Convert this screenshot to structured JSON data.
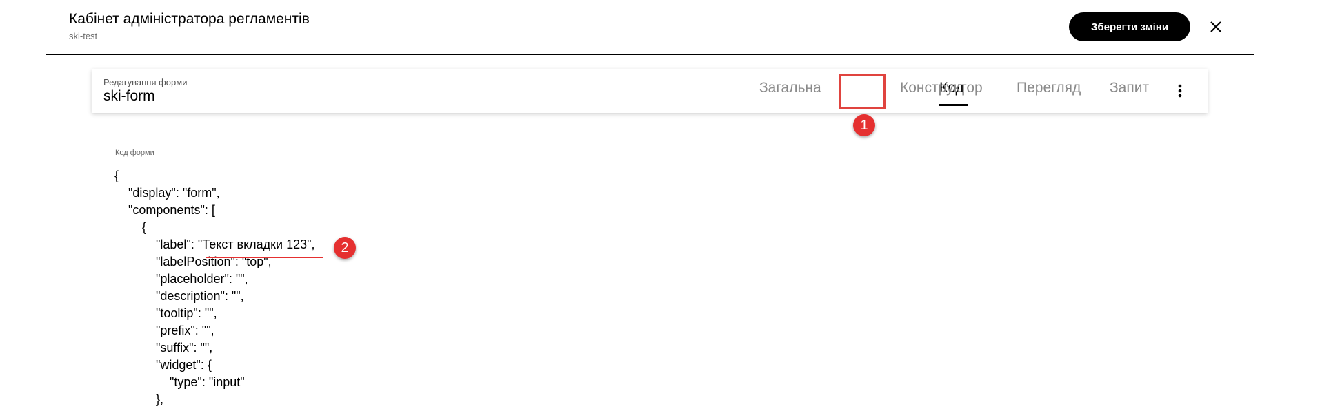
{
  "header": {
    "title": "Кабінет адміністратора регламентів",
    "subtitle": "ski-test",
    "save_label": "Зберегти зміни",
    "close_icon": "close-icon"
  },
  "form_card": {
    "caption": "Редагування форми",
    "title": "ski-form",
    "tabs": [
      {
        "label": "Загальна",
        "active": false
      },
      {
        "label": "Код",
        "active": true
      },
      {
        "label": "Конструктор",
        "active": false
      },
      {
        "label": "Перегляд",
        "active": false
      },
      {
        "label": "Запит",
        "active": false
      }
    ],
    "more_icon": "more-vertical-icon"
  },
  "annotations": {
    "marker_1": "1",
    "marker_2": "2",
    "accent_color": "#e53030"
  },
  "code": {
    "label": "Код форми",
    "lines": [
      "{",
      "    \"display\": \"form\",",
      "    \"components\": [",
      "        {",
      "            \"label\": \"Текст вкладки 123\",",
      "            \"labelPosition\": \"top\",",
      "            \"placeholder\": \"\",",
      "            \"description\": \"\",",
      "            \"tooltip\": \"\",",
      "            \"prefix\": \"\",",
      "            \"suffix\": \"\",",
      "            \"widget\": {",
      "                \"type\": \"input\"",
      "            },"
    ]
  }
}
